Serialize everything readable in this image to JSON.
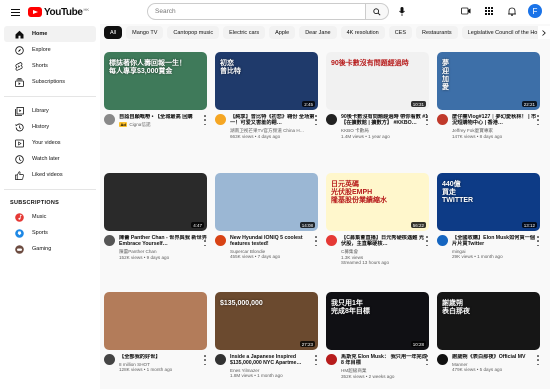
{
  "header": {
    "logo_text": "YouTube",
    "region": "HK",
    "search_placeholder": "Search",
    "avatar_letter": "F"
  },
  "sidebar": {
    "items": [
      {
        "label": "Home",
        "icon": "home-icon",
        "active": true
      },
      {
        "label": "Explore",
        "icon": "compass-icon"
      },
      {
        "label": "Shorts",
        "icon": "shorts-icon"
      },
      {
        "label": "Subscriptions",
        "icon": "subscriptions-icon"
      }
    ],
    "library_items": [
      {
        "label": "Library",
        "icon": "library-icon"
      },
      {
        "label": "History",
        "icon": "history-icon"
      },
      {
        "label": "Your videos",
        "icon": "your-videos-icon"
      },
      {
        "label": "Watch later",
        "icon": "clock-icon"
      },
      {
        "label": "Liked videos",
        "icon": "thumbs-up-icon"
      }
    ],
    "subscriptions_heading": "SUBSCRIPTIONS",
    "subscriptions": [
      {
        "label": "Music",
        "color": "#e53935"
      },
      {
        "label": "Sports",
        "color": "#1e88e5"
      },
      {
        "label": "Gaming",
        "color": "#6d4c41"
      }
    ]
  },
  "chips": [
    "All",
    "Mango TV",
    "Cantopop music",
    "Electric cars",
    "Apple",
    "Dear Jane",
    "4K resolution",
    "CES",
    "Restaurants",
    "Legislative Council of the Ho"
  ],
  "videos": [
    {
      "title": "自諗自願嘅嘢 • 【全城最高 回購",
      "channel": "",
      "views": "",
      "duration": "",
      "ad": true,
      "ad_channel": "Cigna信諾",
      "bg": "#3f7a5a",
      "overlay": "標誌著你人壽回報一生！\n每人專享$3,000賞金",
      "avatar": "#888"
    },
    {
      "title": "【純享】曾比特《初恋》翱份 全场第一！可爱又害羞的翱…",
      "channel": "湖南卫视芒果TV官方频道 China H…",
      "views": "663K views • 4 days ago",
      "duration": "2:45",
      "bg": "#1f3a6b",
      "overlay": "初恋\n曾比特",
      "avatar": "#f5a623"
    },
    {
      "title": "90後卡數沒有問題經過時 帶你看數 #1 【在擴數館 | 擴數方】 #KKBO…",
      "channel": "KKBO 卡數局",
      "views": "1.4M views • 1 year ago",
      "duration": "10:31",
      "bg": "#f1f1f1",
      "overlay": "90後卡數沒有問題經過時",
      "avatar": "#222"
    },
    {
      "title": "麼仔團Vlog#127｜夢幻愛秋林！ | 市況短購物中心 | 香港…",
      "channel": "Jeffrey Fok麼寶專家",
      "views": "147K views • 8 days ago",
      "duration": "22:21",
      "bg": "#3d6fa8",
      "overlay": "夢\n迎\n加\n愛",
      "avatar": "#c0392b"
    },
    {
      "title": "陳蕾 Panther Chan - 世界與我 新世界 Embrace Yourself…",
      "channel": "陳蕾Panther Chan",
      "views": "152K views • 9 days ago",
      "duration": "4:47",
      "bg": "#2a2a2a",
      "overlay": "",
      "avatar": "#555"
    },
    {
      "title": "New Hyundai IONIQ 5 coolest features tested!",
      "channel": "Supercar Blondie",
      "views": "455K views • 7 days ago",
      "duration": "14:08",
      "bg": "#9bb7d4",
      "overlay": "",
      "avatar": "#d84315"
    },
    {
      "title": "【C募集會直播】日元秀硬核遇難 光伏股，主直擊硬核…",
      "channel": "C募集會",
      "views": "1.3K views",
      "views2": "Streamed 13 hours ago",
      "duration": "56:22",
      "bg": "#fff7cc",
      "overlay": "日元英碼\n光伏股EMPH\n隆基股份業績縮水",
      "avatar": "#e53935"
    },
    {
      "title": "【全國收購】Elon Musk如何買一個片片買Twitter",
      "channel": "mingai",
      "views": "29K views • 1 month ago",
      "duration": "13:12",
      "bg": "#0d3b86",
      "overlay": "440億\n買走\nTWITTER",
      "avatar": "#1565c0"
    },
    {
      "title": "【全部我的好世】",
      "channel": "8 million SHOT",
      "views": "128K views • 1 month ago",
      "duration": "",
      "bg": "#b37c5a",
      "overlay": "",
      "avatar": "#444"
    },
    {
      "title": "Inside a Japanese Inspired $135,000,000 NYC Apartme…",
      "channel": "Enes Yilmazer",
      "views": "1.8M views • 1 month ago",
      "duration": "27:23",
      "bg": "#6b4a2f",
      "overlay": "$135,000,000",
      "avatar": "#333"
    },
    {
      "title": "馬斯克 Elon Musk： 我只用一年完成 8 年目標",
      "channel": "HM超級商業",
      "views": "352K views • 2 weeks ago",
      "duration": "10:28",
      "bg": "#101014",
      "overlay": "我只用1年\n完成8年目標",
      "avatar": "#b71c1c"
    },
    {
      "title": "謝歲朔《表白那夜》Official MV",
      "channel": "Manner",
      "views": "479K views • 5 days ago",
      "duration": "",
      "bg": "#161616",
      "overlay": "謝歲朔\n表白那夜",
      "avatar": "#111"
    }
  ]
}
